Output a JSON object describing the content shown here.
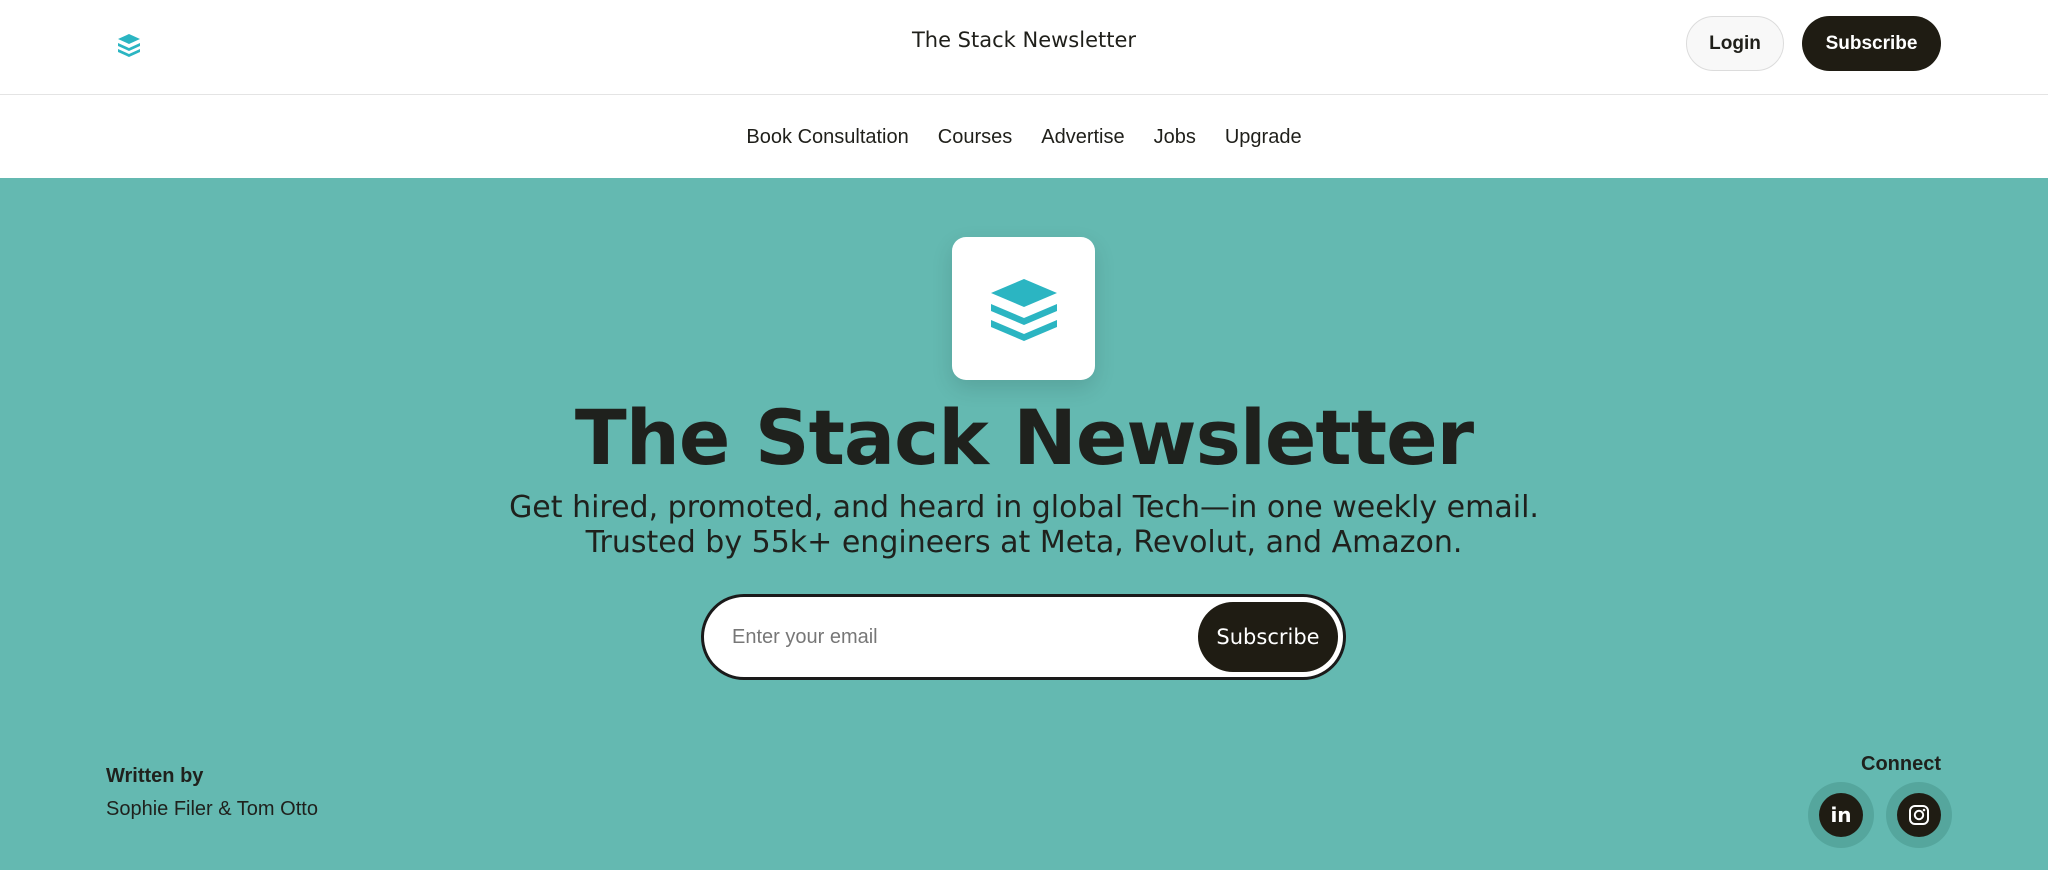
{
  "header": {
    "site_title": "The Stack Newsletter",
    "logo_icon": "stack-layers-icon",
    "login_label": "Login",
    "subscribe_label": "Subscribe"
  },
  "nav": {
    "items": [
      "Book Consultation",
      "Courses",
      "Advertise",
      "Jobs",
      "Upgrade"
    ]
  },
  "hero": {
    "logo_icon": "stack-layers-icon",
    "title": "The Stack Newsletter",
    "subtitle_line1": "Get hired, promoted, and heard in global Tech—in one weekly email.",
    "subtitle_line2": "Trusted by 55k+ engineers at Meta, Revolut, and Amazon.",
    "email_placeholder": "Enter your email",
    "email_value": "",
    "subscribe_label": "Subscribe"
  },
  "footer": {
    "written_by_label": "Written by",
    "authors": "Sophie Filer & Tom Otto",
    "connect_label": "Connect",
    "socials": [
      "linkedin-icon",
      "instagram-icon"
    ]
  },
  "colors": {
    "hero_bg": "#64b9b1",
    "accent": "#2bb5c2",
    "dark_button": "#1f1c13",
    "text": "#1f211d"
  }
}
